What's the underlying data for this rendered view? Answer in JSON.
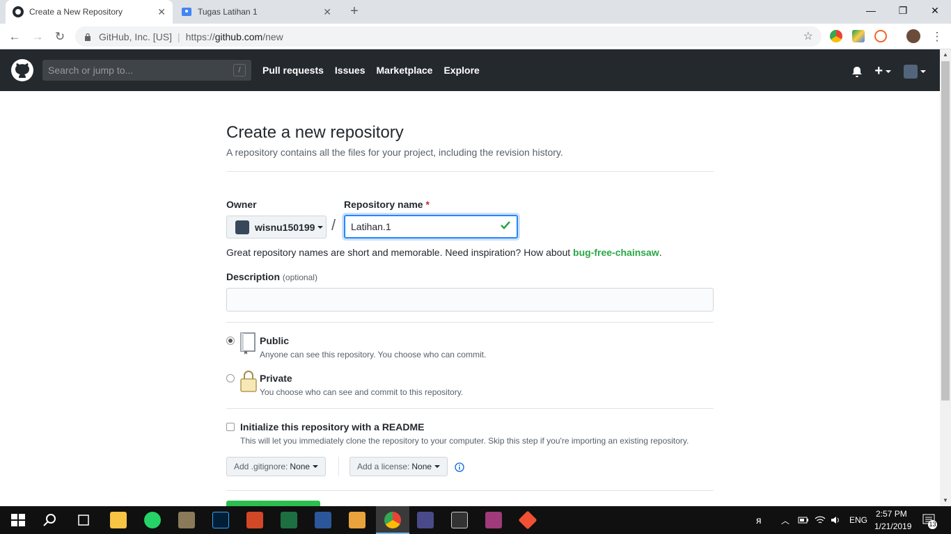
{
  "browser": {
    "tabs": [
      {
        "title": "Create a New Repository",
        "active": true
      },
      {
        "title": "Tugas Latihan 1",
        "active": false
      }
    ],
    "site_identity": "GitHub, Inc. [US]",
    "url_prefix": "https://",
    "url_host": "github.com",
    "url_path": "/new"
  },
  "header": {
    "search_placeholder": "Search or jump to...",
    "search_shortcut": "/",
    "nav": [
      "Pull requests",
      "Issues",
      "Marketplace",
      "Explore"
    ]
  },
  "form": {
    "title": "Create a new repository",
    "subtitle": "A repository contains all the files for your project, including the revision history.",
    "owner_label": "Owner",
    "owner_value": "wisnu150199",
    "separator": "/",
    "repo_label": "Repository name",
    "required_mark": "*",
    "repo_value": "Latihan.1",
    "hint_prefix": "Great repository names are short and memorable. Need inspiration? How about ",
    "hint_suggestion": "bug-free-chainsaw",
    "hint_suffix": ".",
    "description_label": "Description",
    "description_optional": "(optional)",
    "description_value": "",
    "visibility": {
      "selected": "Public",
      "public_title": "Public",
      "public_desc": "Anyone can see this repository. You choose who can commit.",
      "private_title": "Private",
      "private_desc": "You choose who can see and commit to this repository."
    },
    "readme_title": "Initialize this repository with a README",
    "readme_desc": "This will let you immediately clone the repository to your computer. Skip this step if you're importing an existing repository.",
    "readme_checked": false,
    "gitignore_label": "Add .gitignore:",
    "gitignore_value": "None",
    "license_label": "Add a license:",
    "license_value": "None"
  },
  "taskbar": {
    "language": "ENG",
    "time": "2:57 PM",
    "date": "1/21/2019",
    "notifications": "13"
  },
  "colors": {
    "github_header": "#24292e",
    "focus_blue": "#2188ff",
    "success_green": "#28a745",
    "create_button_green": "#2cbe4e"
  }
}
